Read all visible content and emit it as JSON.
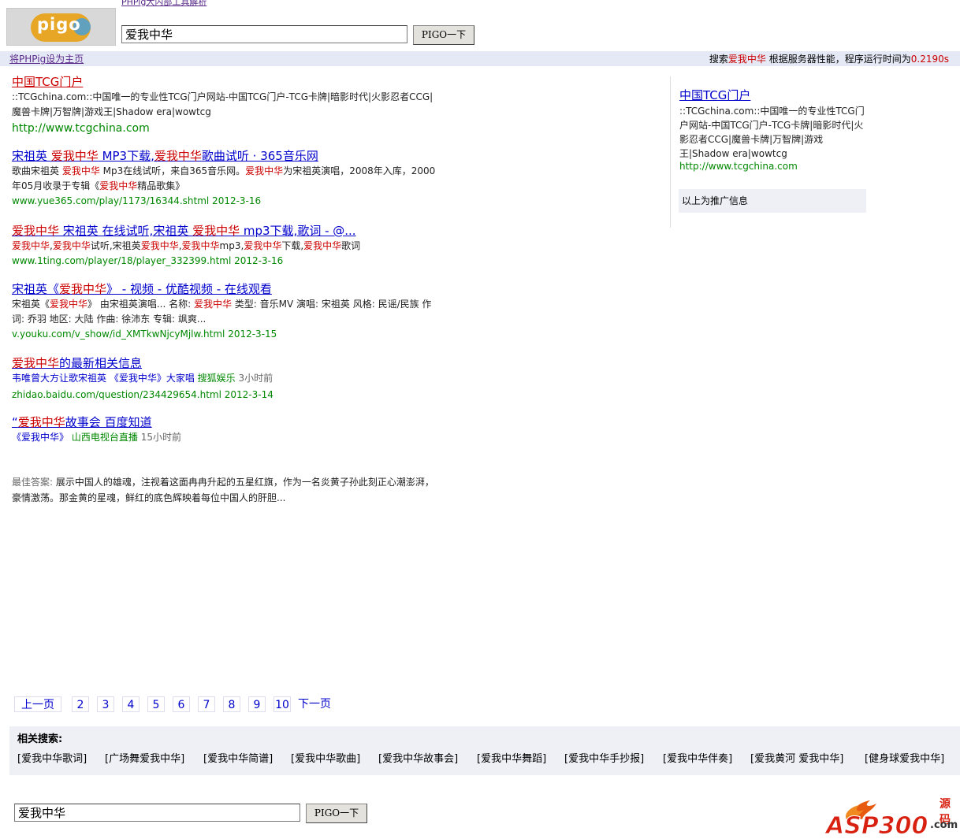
{
  "header": {
    "logo_text": "pigo",
    "top_link": "PHPig大内部工具解析",
    "search_value": "爱我中华",
    "search_button": "PIGO一下"
  },
  "bar": {
    "homepage_link": "将PHPig设为主页",
    "stats_prefix": "搜索",
    "stats_query": "爱我中华",
    "stats_middle": " 根据服务器性能，程序运行时间为",
    "stats_time": "0.2190s"
  },
  "results": [
    {
      "title": "中国TCG门户",
      "snippet": "::TCGchina.com::中国唯一的专业性TCG门户网站-中国TCG门户-TCG卡牌|暗影时代|火影忍者CCG|魔兽卡牌|万智牌|游戏王|Shadow era|wowtcg",
      "url": "http://www.tcgchina.com"
    },
    {
      "title_parts": [
        "宋祖英  ",
        "爱我中华",
        "  MP3下载,",
        "爱我中华",
        "歌曲试听 · 365音乐网"
      ],
      "snippet_parts": [
        "歌曲宋祖英  ",
        "爱我中华",
        "  Mp3在线试听，来自365音乐网。",
        "爱我中华",
        "为宋祖英演唱，2008年入库，2000年05月收录于专辑《",
        "爱我中华",
        "精品歌集》"
      ],
      "url": "www.yue365.com/play/1173/16344.shtml 2012-3-16"
    },
    {
      "title_parts": [
        "爱我中华",
        "  宋祖英  在线试听,宋祖英  ",
        "爱我中华",
        "  mp3下载,歌词 - @..."
      ],
      "snippet_parts": [
        "爱我中华",
        ",",
        "爱我中华",
        "试听,宋祖英",
        "爱我中华",
        ",",
        "爱我中华",
        "mp3,",
        "爱我中华",
        "下载,",
        "爱我中华",
        "歌词"
      ],
      "url": "www.1ting.com/player/18/player_332399.html 2012-3-16"
    },
    {
      "title_parts": [
        "宋祖英《",
        "爱我中华",
        "》 - 视频 - 优酷视频 - 在线观看"
      ],
      "snippet_parts": [
        "宋祖英《",
        "爱我中华",
        "》  由宋祖英演唱... 名称: ",
        "爱我中华",
        "  类型: 音乐MV 演唱: 宋祖英  风格: 民谣/民族  作词: 乔羽  地区: 大陆  作曲: 徐沛东  专辑: 飒爽..."
      ],
      "url": "v.youku.com/v_show/id_XMTkwNjcyMjlw.html 2012-3-15"
    },
    {
      "title_parts": [
        "爱我中华",
        "的最新相关信息"
      ],
      "sub_link": "韦唯曾大方让歌宋祖英 《爱我中华》大家唱",
      "sub_source": "搜狐娱乐",
      "sub_time": "3小时前",
      "url": "zhidao.baidu.com/question/234429654.html 2012-3-14"
    },
    {
      "title_parts": [
        "“",
        "爱我中华",
        "故事会  百度知道"
      ],
      "sub_link": "《爱我中华》",
      "sub_source": "山西电视台直播",
      "sub_time": "15小时前"
    }
  ],
  "best_answer": {
    "label": "最佳答案: ",
    "text": "展示中国人的雄魂，注视着这面冉冉升起的五星红旗，作为一名炎黄子孙此刻正心潮澎湃，豪情激荡。那金黄的星魂，鲜红的底色辉映着每位中国人的肝胆..."
  },
  "ad": {
    "title": "中国TCG门户",
    "snippet": "::TCGchina.com::中国唯一的专业性TCG门户网站-中国TCG门户-TCG卡牌|暗影时代|火影忍者CCG|魔兽卡牌|万智牌|游戏王|Shadow era|wowtcg",
    "url": "http://www.tcgchina.com",
    "note": "以上为推广信息"
  },
  "pager": {
    "prev": "上一页",
    "pages": [
      "2",
      "3",
      "4",
      "5",
      "6",
      "7",
      "8",
      "9",
      "10"
    ],
    "next": "下一页"
  },
  "related": {
    "label": "相关搜索:",
    "items": [
      "爱我中华歌词",
      "广场舞爱我中华",
      "爱我中华简谱",
      "爱我中华歌曲",
      "爱我中华故事会",
      "爱我中华舞蹈",
      "爱我中华手抄报",
      "爱我中华伴奏",
      "爱我黄河  爱我中华",
      "健身球爱我中华"
    ]
  },
  "footer": {
    "search_value": "爱我中华",
    "search_button": "PIGO一下",
    "logo_text": "ASP300",
    "logo_cn": "源码",
    "logo_domain": ".com"
  },
  "colors": {
    "accent_bar": "#e5e9f5",
    "highlight": "#cc0000",
    "url": "#008800",
    "link": "#0000cc"
  }
}
